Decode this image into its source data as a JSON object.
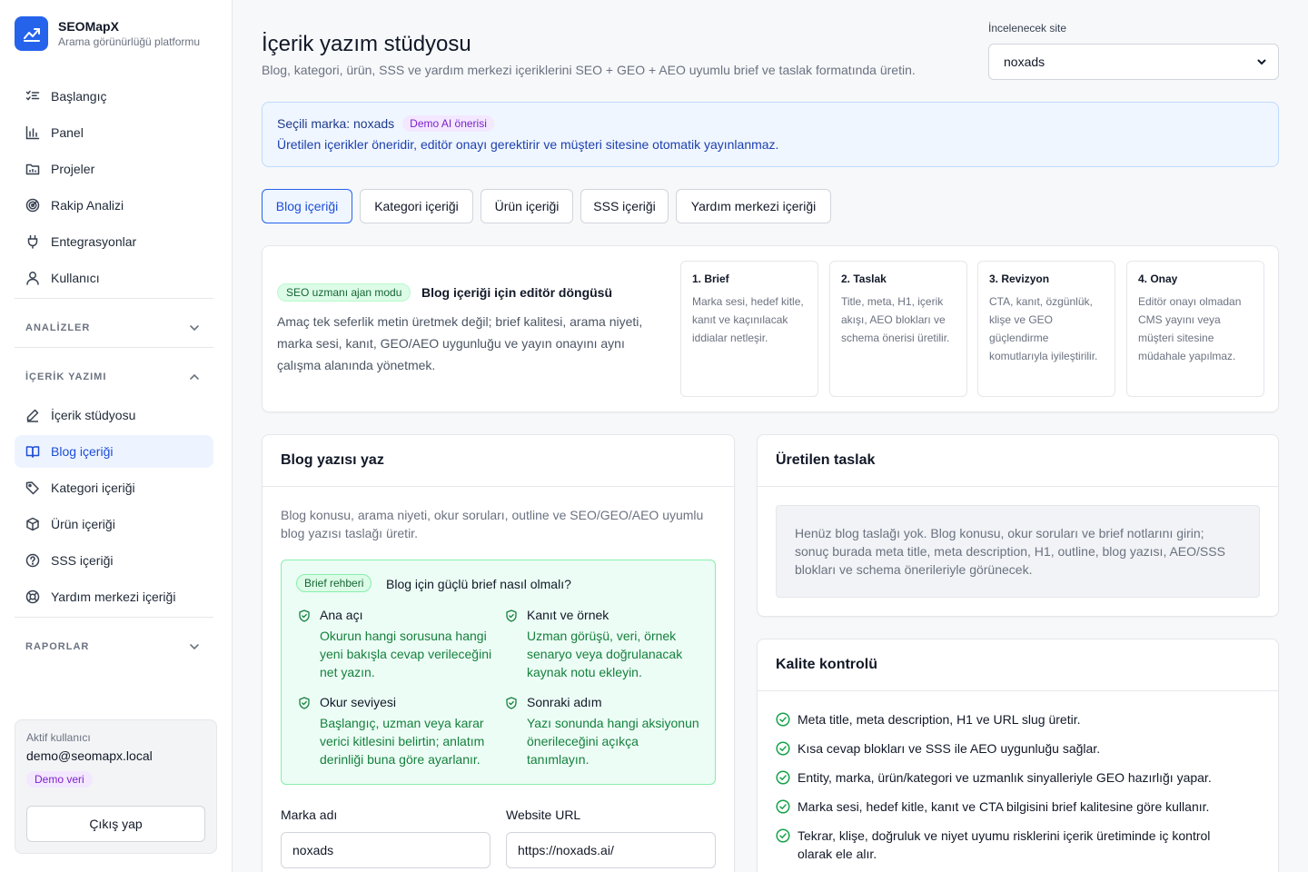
{
  "brand": {
    "name": "SEOMapX",
    "tagline": "Arama görünürlüğü platformu"
  },
  "nav": {
    "top": [
      {
        "label": "Başlangıç",
        "icon": "checklist-icon"
      },
      {
        "label": "Panel",
        "icon": "bar-chart-icon"
      },
      {
        "label": "Projeler",
        "icon": "folder-icon"
      },
      {
        "label": "Rakip Analizi",
        "icon": "radar-icon"
      },
      {
        "label": "Entegrasyonlar",
        "icon": "plug-icon"
      },
      {
        "label": "Kullanıcı",
        "icon": "user-icon"
      }
    ],
    "sections": {
      "analizler": "ANALİZLER",
      "icerik": "İÇERİK YAZIMI",
      "raporlar": "RAPORLAR"
    },
    "content_items": [
      {
        "label": "İçerik stüdyosu",
        "icon": "pen-icon"
      },
      {
        "label": "Blog içeriği",
        "icon": "book-icon",
        "active": true
      },
      {
        "label": "Kategori içeriği",
        "icon": "tag-icon"
      },
      {
        "label": "Ürün içeriği",
        "icon": "box-icon"
      },
      {
        "label": "SSS içeriği",
        "icon": "question-icon"
      },
      {
        "label": "Yardım merkezi içeriği",
        "icon": "lifebuoy-icon"
      }
    ]
  },
  "user": {
    "label": "Aktif kullanıcı",
    "email": "demo@seomapx.local",
    "badge": "Demo veri",
    "logout": "Çıkış yap"
  },
  "header": {
    "title": "İçerik yazım stüdyosu",
    "subtitle": "Blog, kategori, ürün, SSS ve yardım merkezi içeriklerini SEO + GEO + AEO uyumlu brief ve taslak formatında üretin.",
    "site_label": "İncelenecek site",
    "site_value": "noxads"
  },
  "notice": {
    "title": "Seçili marka: noxads",
    "badge": "Demo AI önerisi",
    "text": "Üretilen içerikler öneridir, editör onayı gerektirir ve müşteri sitesine otomatik yayınlanmaz."
  },
  "tabs": [
    "Blog içeriği",
    "Kategori içeriği",
    "Ürün içeriği",
    "SSS içeriği",
    "Yardım merkezi içeriği"
  ],
  "mode": {
    "badge": "SEO uzmanı ajan modu",
    "title": "Blog içeriği için editör döngüsü",
    "description": "Amaç tek seferlik metin üretmek değil; brief kalitesi, arama niyeti, marka sesi, kanıt, GEO/AEO uygunluğu ve yayın onayını aynı çalışma alanında yönetmek.",
    "steps": [
      {
        "title": "1. Brief",
        "text": "Marka sesi, hedef kitle, kanıt ve kaçınılacak iddialar netleşir."
      },
      {
        "title": "2. Taslak",
        "text": "Title, meta, H1, içerik akışı, AEO blokları ve schema önerisi üretilir."
      },
      {
        "title": "3. Revizyon",
        "text": "CTA, kanıt, özgünlük, klişe ve GEO güçlendirme komutlarıyla iyileştirilir."
      },
      {
        "title": "4. Onay",
        "text": "Editör onayı olmadan CMS yayını veya müşteri sitesine müdahale yapılmaz."
      }
    ]
  },
  "blog_form": {
    "title": "Blog yazısı yaz",
    "description": "Blog konusu, arama niyeti, okur soruları, outline ve SEO/GEO/AEO uyumlu blog yazısı taslağı üretir.",
    "brief_badge": "Brief rehberi",
    "brief_title": "Blog için güçlü brief nasıl olmalı?",
    "tips": [
      {
        "title": "Ana açı",
        "text": "Okurun hangi sorusuna hangi yeni bakışla cevap verileceğini net yazın."
      },
      {
        "title": "Kanıt ve örnek",
        "text": "Uzman görüşü, veri, örnek senaryo veya doğrulanacak kaynak notu ekleyin."
      },
      {
        "title": "Okur seviyesi",
        "text": "Başlangıç, uzman veya karar verici kitlesini belirtin; anlatım derinliği buna göre ayarlanır."
      },
      {
        "title": "Sonraki adım",
        "text": "Yazı sonunda hangi aksiyonun önerileceğini açıkça tanımlayın."
      }
    ],
    "brand_label": "Marka adı",
    "brand_value": "noxads",
    "url_label": "Website URL",
    "url_value": "https://noxads.ai/"
  },
  "draft": {
    "title": "Üretilen taslak",
    "empty": "Henüz blog taslağı yok. Blog konusu, okur soruları ve brief notlarını girin; sonuç burada meta title, meta description, H1, outline, blog yazısı, AEO/SSS blokları ve schema önerileriyle görünecek."
  },
  "quality": {
    "title": "Kalite kontrolü",
    "items": [
      "Meta title, meta description, H1 ve URL slug üretir.",
      "Kısa cevap blokları ve SSS ile AEO uygunluğu sağlar.",
      "Entity, marka, ürün/kategori ve uzmanlık sinyalleriyle GEO hazırlığı yapar.",
      "Marka sesi, hedef kitle, kanıt ve CTA bilgisini brief kalitesine göre kullanır.",
      "Tekrar, klişe, doğruluk ve niyet uyumu risklerini içerik üretiminde iç kontrol olarak ele alır."
    ]
  },
  "colors": {
    "accent": "#2563eb",
    "success": "#16a34a",
    "demo": "#7e22ce"
  }
}
